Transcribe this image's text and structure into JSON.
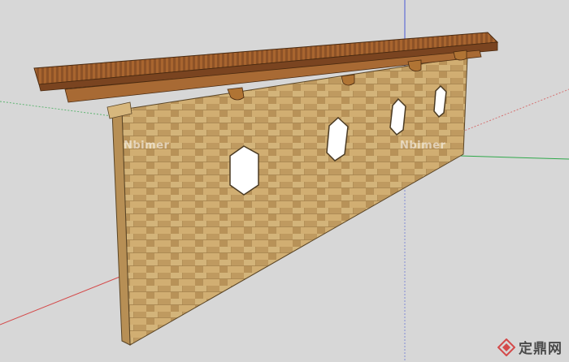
{
  "app": {
    "view": "3D model viewport"
  },
  "colors": {
    "background": "#d7d7d7",
    "wall_stone": "#c9a66a",
    "roof_wood": "#9a5a2a",
    "axis_red": "#d44a4a",
    "axis_green": "#2fa84a",
    "axis_blue": "#4a5ad4"
  },
  "watermarks": {
    "left": "Nbimer",
    "right": "Nbimer"
  },
  "logo": {
    "text": "定鼎网",
    "icon": "logo-diamond-icon"
  }
}
